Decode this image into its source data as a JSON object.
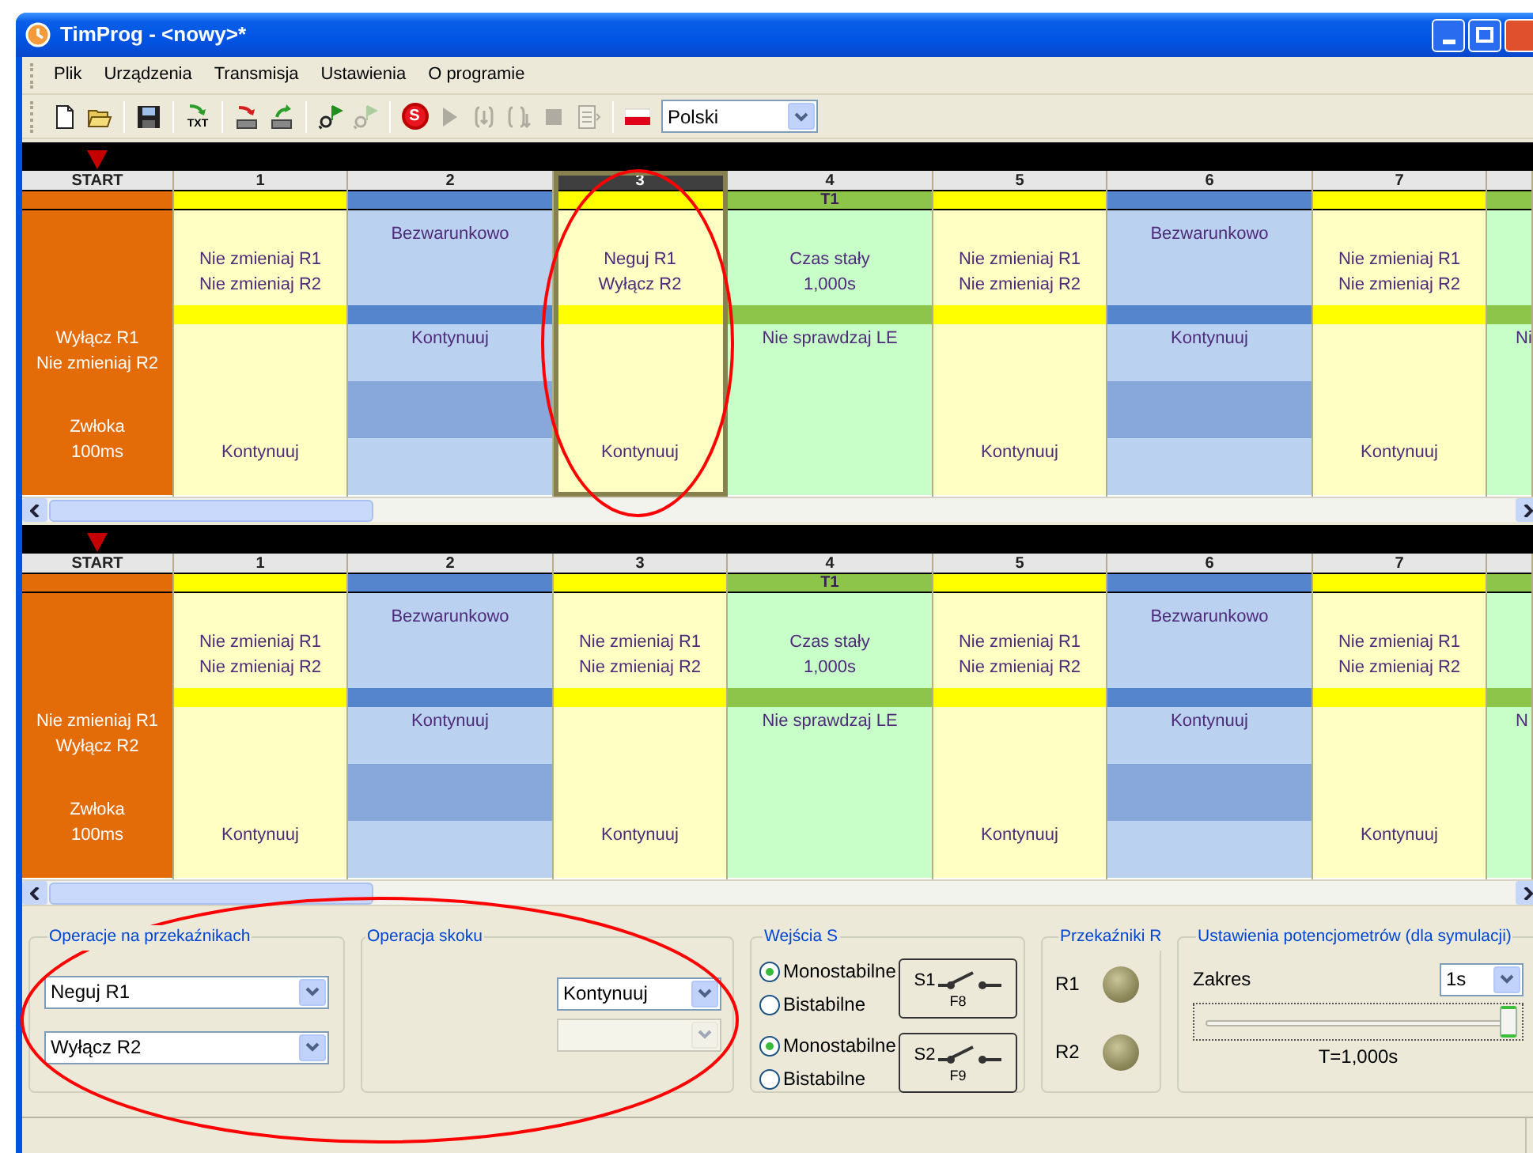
{
  "window": {
    "title": "TimProg - <nowy>*"
  },
  "menu": [
    "Plik",
    "Urządzenia",
    "Transmisja",
    "Ustawienia",
    "O programie"
  ],
  "toolbar": [
    {
      "kind": "new",
      "disabled": false
    },
    {
      "kind": "open",
      "disabled": false
    },
    {
      "kind": "separator"
    },
    {
      "kind": "save",
      "disabled": false
    },
    {
      "kind": "separator"
    },
    {
      "kind": "export",
      "label": "TXT",
      "disabled": false
    },
    {
      "kind": "separator"
    },
    {
      "kind": "download",
      "disabled": false
    },
    {
      "kind": "upload",
      "disabled": false
    },
    {
      "kind": "separator"
    },
    {
      "kind": "find",
      "disabled": false
    },
    {
      "kind": "find",
      "disabled": true
    },
    {
      "kind": "separator"
    },
    {
      "kind": "record",
      "label": "S",
      "disabled": false
    },
    {
      "kind": "play",
      "disabled": true
    },
    {
      "kind": "step-in",
      "disabled": true
    },
    {
      "kind": "step-out",
      "disabled": true
    },
    {
      "kind": "stop",
      "disabled": true
    },
    {
      "kind": "report",
      "disabled": true
    },
    {
      "kind": "separator"
    },
    {
      "kind": "flag",
      "disabled": false
    }
  ],
  "language": {
    "value": "Polski"
  },
  "grids": [
    {
      "columns": [
        {
          "kind": "start",
          "header": "START",
          "selected": false,
          "lower": [
            "Wyłącz R1",
            "Nie zmieniaj R2"
          ],
          "footer": [
            "Zwłoka",
            "100ms"
          ]
        },
        {
          "kind": "relay",
          "header": "1",
          "selected": false,
          "upper": [
            "Nie zmieniaj R1",
            "Nie zmieniaj R2"
          ],
          "footer": [
            "Kontynuuj"
          ]
        },
        {
          "kind": "jump",
          "header": "2",
          "selected": false,
          "upper": [
            "Bezwarunkowo"
          ],
          "lower": [
            "Kontynuuj"
          ]
        },
        {
          "kind": "relay",
          "header": "3",
          "selected": true,
          "upper": [
            "Neguj R1",
            "Wyłącz R2"
          ],
          "footer": [
            "Kontynuuj"
          ]
        },
        {
          "kind": "timer",
          "header": "4",
          "selected": false,
          "tag": "T1",
          "upper": [
            "Czas stały",
            "1,000s"
          ],
          "lower": [
            "Nie sprawdzaj LE"
          ]
        },
        {
          "kind": "relay",
          "header": "5",
          "selected": false,
          "upper": [
            "Nie zmieniaj R1",
            "Nie zmieniaj R2"
          ],
          "footer": [
            "Kontynuuj"
          ]
        },
        {
          "kind": "jump",
          "header": "6",
          "selected": false,
          "upper": [
            "Bezwarunkowo"
          ],
          "lower": [
            "Kontynuuj"
          ]
        },
        {
          "kind": "relay",
          "header": "7",
          "selected": false,
          "upper": [
            "Nie zmieniaj R1",
            "Nie zmieniaj R2"
          ],
          "footer": [
            "Kontynuuj"
          ]
        },
        {
          "kind": "timer",
          "selected": false,
          "cut": true,
          "lower": [
            "Ni"
          ]
        }
      ]
    },
    {
      "columns": [
        {
          "kind": "start",
          "header": "START",
          "selected": false,
          "lower": [
            "Nie zmieniaj R1",
            "Wyłącz R2"
          ],
          "footer": [
            "Zwłoka",
            "100ms"
          ]
        },
        {
          "kind": "relay",
          "header": "1",
          "selected": false,
          "upper": [
            "Nie zmieniaj R1",
            "Nie zmieniaj R2"
          ],
          "footer": [
            "Kontynuuj"
          ]
        },
        {
          "kind": "jump",
          "header": "2",
          "selected": false,
          "upper": [
            "Bezwarunkowo"
          ],
          "lower": [
            "Kontynuuj"
          ]
        },
        {
          "kind": "relay",
          "header": "3",
          "selected": false,
          "upper": [
            "Nie zmieniaj R1",
            "Nie zmieniaj R2"
          ],
          "footer": [
            "Kontynuuj"
          ]
        },
        {
          "kind": "timer",
          "header": "4",
          "selected": false,
          "tag": "T1",
          "upper": [
            "Czas stały",
            "1,000s"
          ],
          "lower": [
            "Nie sprawdzaj LE"
          ]
        },
        {
          "kind": "relay",
          "header": "5",
          "selected": false,
          "upper": [
            "Nie zmieniaj R1",
            "Nie zmieniaj R2"
          ],
          "footer": [
            "Kontynuuj"
          ]
        },
        {
          "kind": "jump",
          "header": "6",
          "selected": false,
          "upper": [
            "Bezwarunkowo"
          ],
          "lower": [
            "Kontynuuj"
          ]
        },
        {
          "kind": "relay",
          "header": "7",
          "selected": false,
          "upper": [
            "Nie zmieniaj R1",
            "Nie zmieniaj R2"
          ],
          "footer": [
            "Kontynuuj"
          ]
        },
        {
          "kind": "timer",
          "selected": false,
          "cut": true,
          "lower": [
            "N"
          ]
        }
      ]
    }
  ],
  "relay_ops": {
    "title": "Operacje na przekaźnikach",
    "selects": [
      {
        "value": "Neguj R1"
      },
      {
        "value": "Wyłącz R2"
      }
    ]
  },
  "jump_op": {
    "title": "Operacja skoku",
    "selects": [
      {
        "value": "Kontynuuj",
        "disabled": false
      },
      {
        "disabled": true
      }
    ]
  },
  "inputs": {
    "title": "Wejścia S",
    "items": [
      {
        "switch": "S1",
        "key": "F8",
        "options": [
          {
            "label": "Monostabilne",
            "selected": true
          },
          {
            "label": "Bistabilne",
            "selected": false
          }
        ]
      },
      {
        "switch": "S2",
        "key": "F9",
        "options": [
          {
            "label": "Monostabilne",
            "selected": true
          },
          {
            "label": "Bistabilne",
            "selected": false
          }
        ]
      }
    ]
  },
  "relays": {
    "title": "Przekaźniki R",
    "items": [
      {
        "label": "R1",
        "on": false
      },
      {
        "label": "R2",
        "on": false
      }
    ]
  },
  "pots": {
    "title": "Ustawienia potencjometrów (dla symulacji)",
    "range_label": "Zakres",
    "range_value": "1s",
    "level": 1,
    "reading": "T=1,000s"
  }
}
